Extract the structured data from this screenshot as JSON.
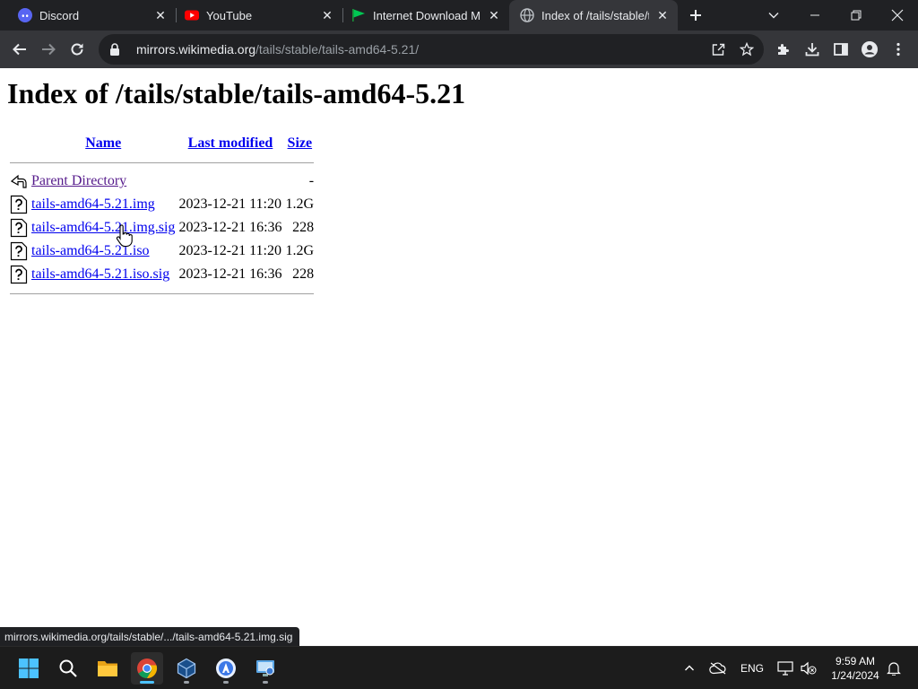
{
  "browser": {
    "tabs": [
      {
        "title": "Discord",
        "icon": "discord-icon",
        "color": "#5865f2"
      },
      {
        "title": "YouTube",
        "icon": "youtube-icon",
        "color": "#ff0000"
      },
      {
        "title": "Internet Download Ma",
        "icon": "idm-flag-icon",
        "color": "#00c853"
      },
      {
        "title": "Index of /tails/stable/t",
        "icon": "globe-icon",
        "active": true
      }
    ],
    "url": {
      "host": "mirrors.wikimedia.org",
      "path": "/tails/stable/tails-amd64-5.21/"
    },
    "status_text": "mirrors.wikimedia.org/tails/stable/.../tails-amd64-5.21.img.sig"
  },
  "page": {
    "heading": "Index of /tails/stable/tails-amd64-5.21",
    "columns": {
      "name": "Name",
      "modified": "Last modified",
      "size": "Size"
    },
    "rows": [
      {
        "name": "Parent Directory",
        "modified": "",
        "size": "-",
        "icon": "back-arrow-icon",
        "visited": true
      },
      {
        "name": "tails-amd64-5.21.img",
        "modified": "2023-12-21 11:20",
        "size": "1.2G",
        "icon": "unknown-file-icon"
      },
      {
        "name": "tails-amd64-5.21.img.sig",
        "modified": "2023-12-21 16:36",
        "size": "228",
        "icon": "unknown-file-icon"
      },
      {
        "name": "tails-amd64-5.21.iso",
        "modified": "2023-12-21 11:20",
        "size": "1.2G",
        "icon": "unknown-file-icon"
      },
      {
        "name": "tails-amd64-5.21.iso.sig",
        "modified": "2023-12-21 16:36",
        "size": "228",
        "icon": "unknown-file-icon"
      }
    ]
  },
  "taskbar": {
    "apps": [
      "windows-start-icon",
      "search-icon",
      "file-explorer-icon",
      "chrome-icon",
      "virtualbox-icon",
      "app-icon",
      "remote-desktop-icon"
    ],
    "language": "ENG",
    "time": "9:59 AM",
    "date": "1/24/2024"
  },
  "colors": {
    "link": "#0000ee",
    "visited_link": "#551a8b",
    "chrome_dark": "#202124",
    "toolbar": "#35363a",
    "taskbar": "#1c1c1c"
  }
}
